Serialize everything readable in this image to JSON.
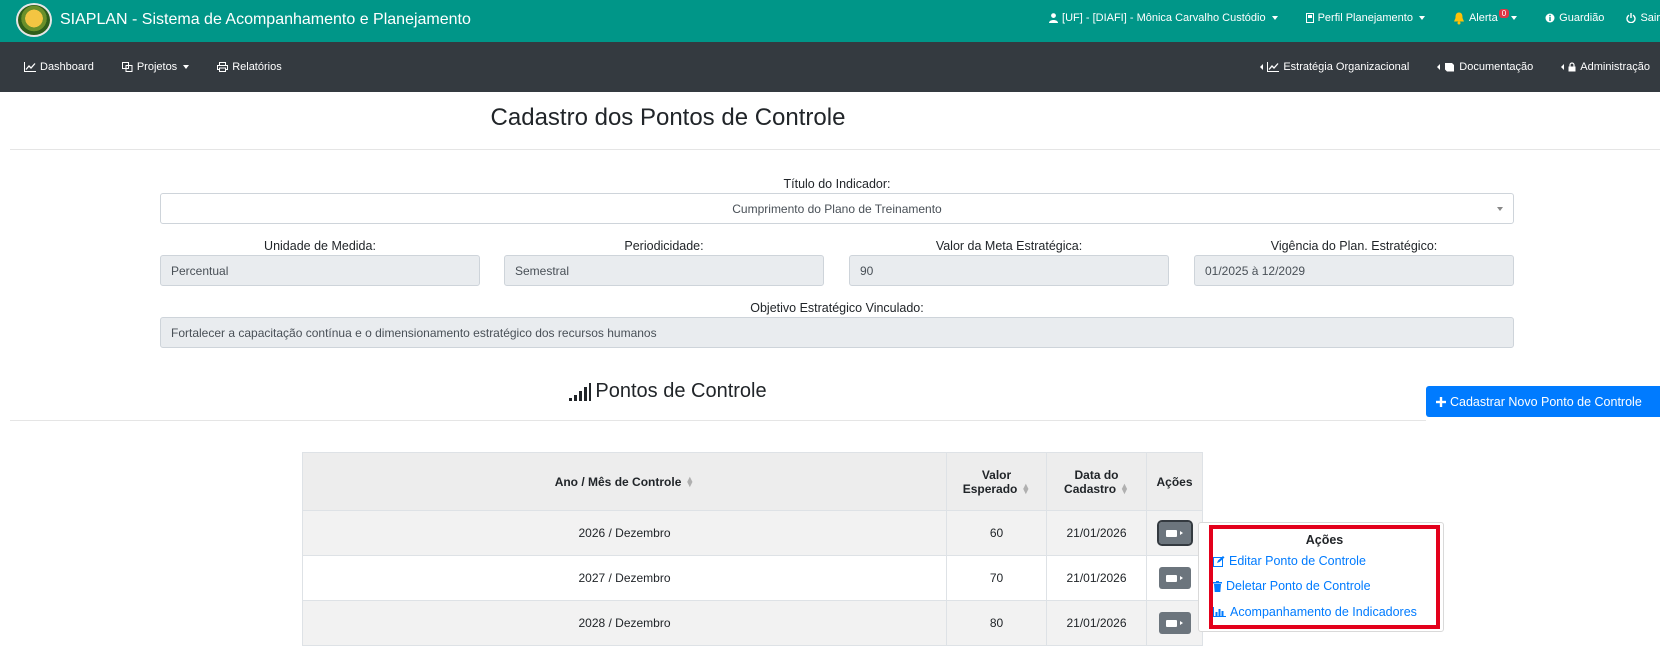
{
  "topbar": {
    "app_title": "SIAPLAN - Sistema de Acompanhamento e Planejamento",
    "user": "[UF] - [DIAFI] - Mônica Carvalho Custódio",
    "profile": "Perfil Planejamento",
    "alert_label": "Alerta",
    "alert_count": "0",
    "guardian": "Guardião",
    "logout": "Sair"
  },
  "nav": {
    "dashboard": "Dashboard",
    "projetos": "Projetos",
    "relatorios": "Relatórios",
    "estrategia": "Estratégia Organizacional",
    "documentacao": "Documentação",
    "administracao": "Administração"
  },
  "page": {
    "title": "Cadastro dos Pontos de Controle"
  },
  "form": {
    "titulo_label": "Título do Indicador:",
    "titulo_value": "Cumprimento do Plano de Treinamento",
    "unidade_label": "Unidade de Medida:",
    "unidade_value": "Percentual",
    "periodicidade_label": "Periodicidade:",
    "periodicidade_value": "Semestral",
    "meta_label": "Valor da Meta Estratégica:",
    "meta_value": "90",
    "vigencia_label": "Vigência do Plan. Estratégico:",
    "vigencia_value": "01/2025 à 12/2029",
    "objetivo_label": "Objetivo Estratégico Vinculado:",
    "objetivo_value": "Fortalecer a capacitação contínua e o dimensionamento estratégico dos recursos humanos"
  },
  "section": {
    "title": "Pontos de Controle",
    "new_button": "Cadastrar Novo Ponto de Controle"
  },
  "table": {
    "headers": {
      "ano_mes": "Ano / Mês de Controle",
      "valor_line1": "Valor",
      "valor_line2": "Esperado",
      "data_line1": "Data do",
      "data_line2": "Cadastro",
      "acoes": "Ações"
    },
    "rows": [
      {
        "ano_mes": "2026 / Dezembro",
        "valor": "60",
        "data": "21/01/2026"
      },
      {
        "ano_mes": "2027 / Dezembro",
        "valor": "70",
        "data": "21/01/2026"
      },
      {
        "ano_mes": "2028 / Dezembro",
        "valor": "80",
        "data": "21/01/2026"
      }
    ]
  },
  "dropdown": {
    "title": "Ações",
    "edit": "Editar Ponto de Controle",
    "delete": "Deletar Ponto de Controle",
    "track": "Acompanhamento de Indicadores"
  },
  "colors": {
    "topbar": "#009688",
    "navbar": "#343a40",
    "primary": "#007bff",
    "highlight": "#e3001b",
    "action_button": "#6c757d"
  }
}
